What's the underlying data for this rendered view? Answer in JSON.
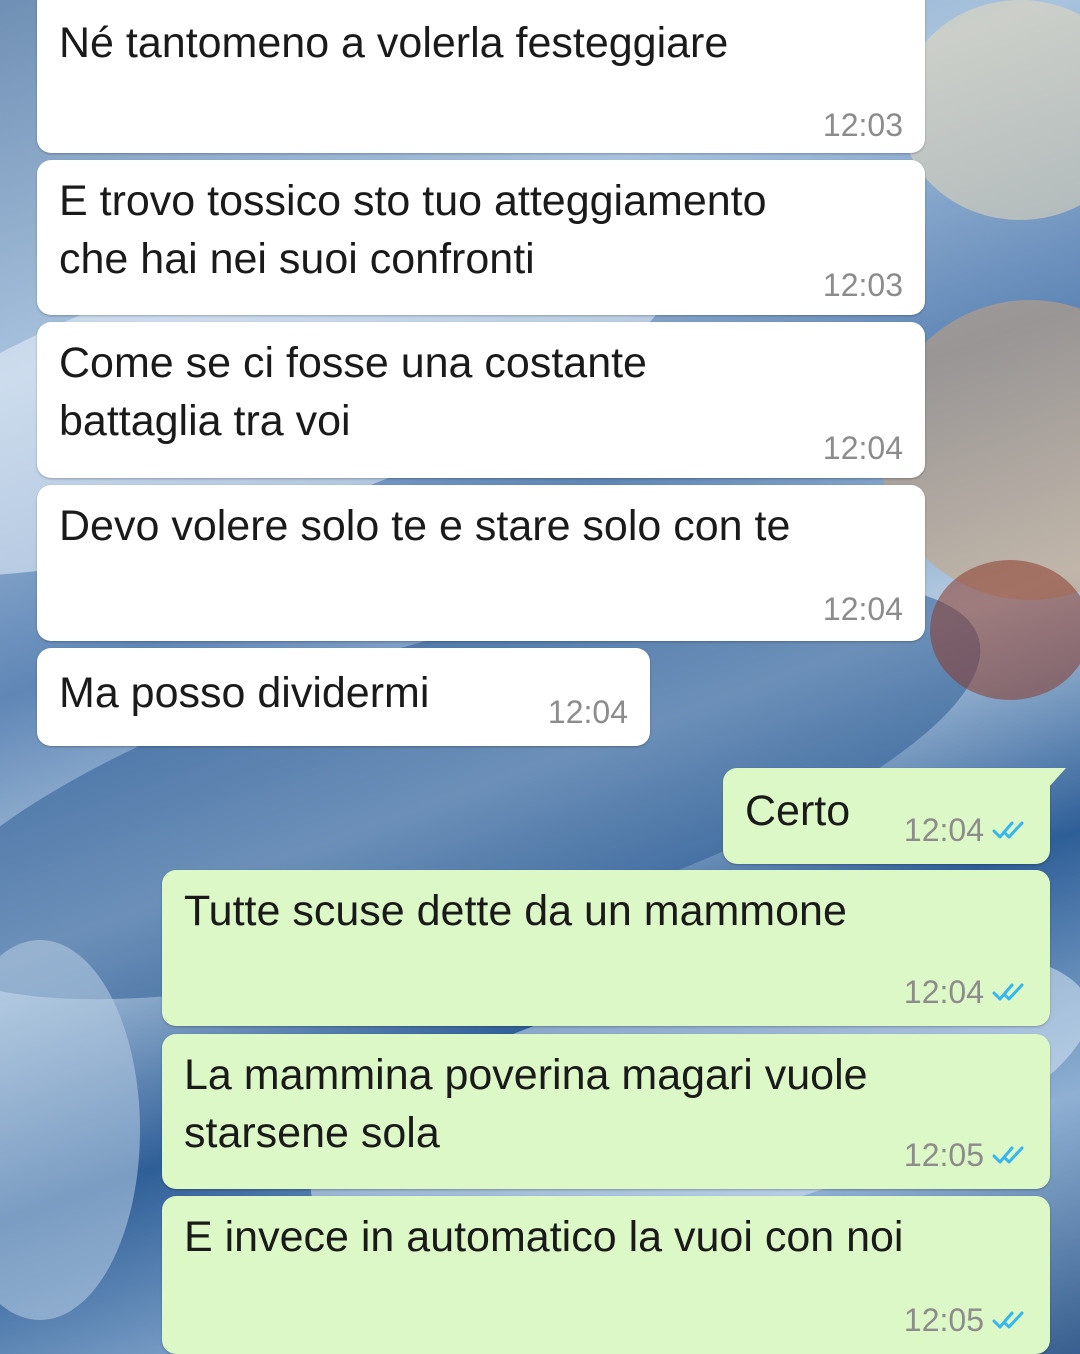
{
  "colors": {
    "incoming_bubble": "#ffffff",
    "outgoing_bubble": "#dcf8c6",
    "time_text": "#8c8c8c",
    "read_ticks": "#34b7f1"
  },
  "messages": [
    {
      "direction": "in",
      "text": "Né tantomeno a volerla festeggiare",
      "time": "12:03"
    },
    {
      "direction": "in",
      "text": "E trovo tossico sto tuo atteggiamento\nche hai nei suoi confronti",
      "time": "12:03"
    },
    {
      "direction": "in",
      "text": "Come se ci fosse una costante\nbattaglia tra voi",
      "time": "12:04"
    },
    {
      "direction": "in",
      "text": "Devo volere solo te e stare solo con te",
      "time": "12:04"
    },
    {
      "direction": "in",
      "text": "Ma posso dividermi",
      "time": "12:04"
    },
    {
      "direction": "out",
      "text": "Certo",
      "time": "12:04",
      "status_icon": "double-check-read-icon"
    },
    {
      "direction": "out",
      "text": "Tutte scuse dette da un mammone",
      "time": "12:04",
      "status_icon": "double-check-read-icon"
    },
    {
      "direction": "out",
      "text": "La mammina poverina magari vuole\nstarsene sola",
      "time": "12:05",
      "status_icon": "double-check-read-icon"
    },
    {
      "direction": "out",
      "text": "E invece in automatico la vuoi con noi",
      "time": "12:05",
      "status_icon": "double-check-read-icon"
    }
  ]
}
